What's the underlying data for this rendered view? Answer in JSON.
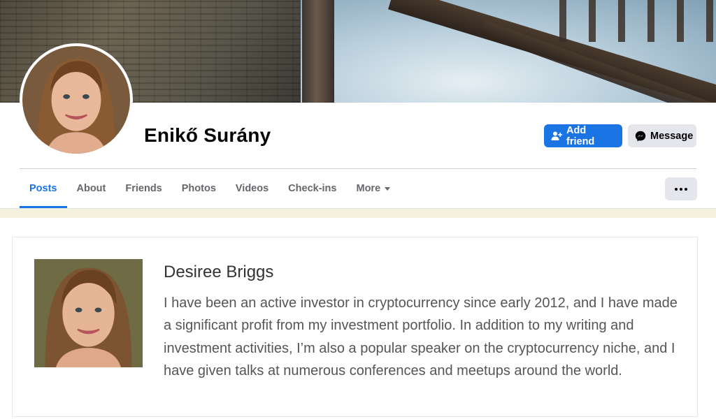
{
  "profile": {
    "name": "Enikő Surány"
  },
  "actions": {
    "add_friend_label": "Add friend",
    "message_label": "Message"
  },
  "tabs": [
    {
      "label": "Posts",
      "active": true
    },
    {
      "label": "About"
    },
    {
      "label": "Friends"
    },
    {
      "label": "Photos"
    },
    {
      "label": "Videos"
    },
    {
      "label": "Check-ins"
    },
    {
      "label": "More"
    }
  ],
  "author": {
    "name": "Desiree Briggs",
    "bio": "I have been an active investor in cryptocurrency since early 2012, and I have made a significant profit from my investment portfolio. In addition to my writing and investment activities, I’m also a popular speaker on the cryptocurrency niche, and I have given talks at numerous conferences and meetups around the world."
  },
  "colors": {
    "accent": "#1b74e4",
    "secondary_button": "#e4e6eb",
    "text_primary": "#050505",
    "text_secondary": "#65676b"
  },
  "icons": {
    "add_friend": "person-plus-icon",
    "message": "messenger-icon",
    "more_caret": "caret-down-icon",
    "more_options": "ellipsis-icon"
  }
}
